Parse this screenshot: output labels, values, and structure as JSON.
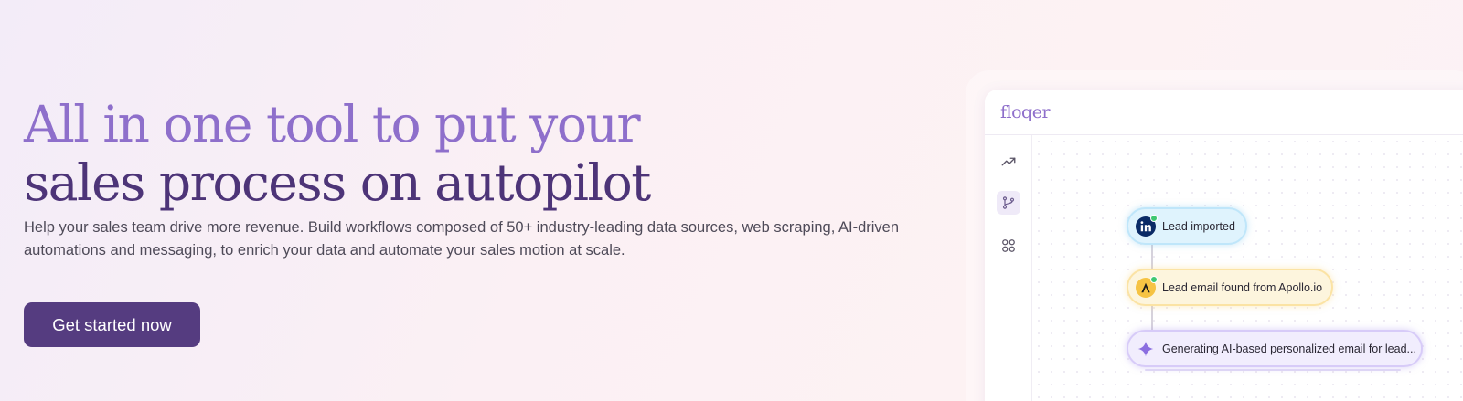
{
  "hero": {
    "headline_line1": "All in one tool to put your",
    "headline_line2": "sales process on autopilot",
    "subtext": "Help your sales team drive more revenue. Build workflows composed of 50+ industry-leading data sources, web scraping, AI-driven automations and messaging, to enrich your data and automate your sales motion at scale.",
    "cta_label": "Get started now"
  },
  "mockup": {
    "logo": "floqer",
    "sidebar_icons": [
      "trend-up-icon",
      "git-branch-icon",
      "apps-grid-icon"
    ],
    "nodes": [
      {
        "label": "Lead imported",
        "icon": "linkedin-icon"
      },
      {
        "label": "Lead email found from Apollo.io",
        "icon": "apollo-icon"
      },
      {
        "label": "Generating AI-based personalized email for lead...",
        "icon": "sparkle-icon"
      }
    ]
  },
  "colors": {
    "headline_light": "#8e6fcb",
    "headline_dark": "#4d3478",
    "cta": "#553c80"
  }
}
